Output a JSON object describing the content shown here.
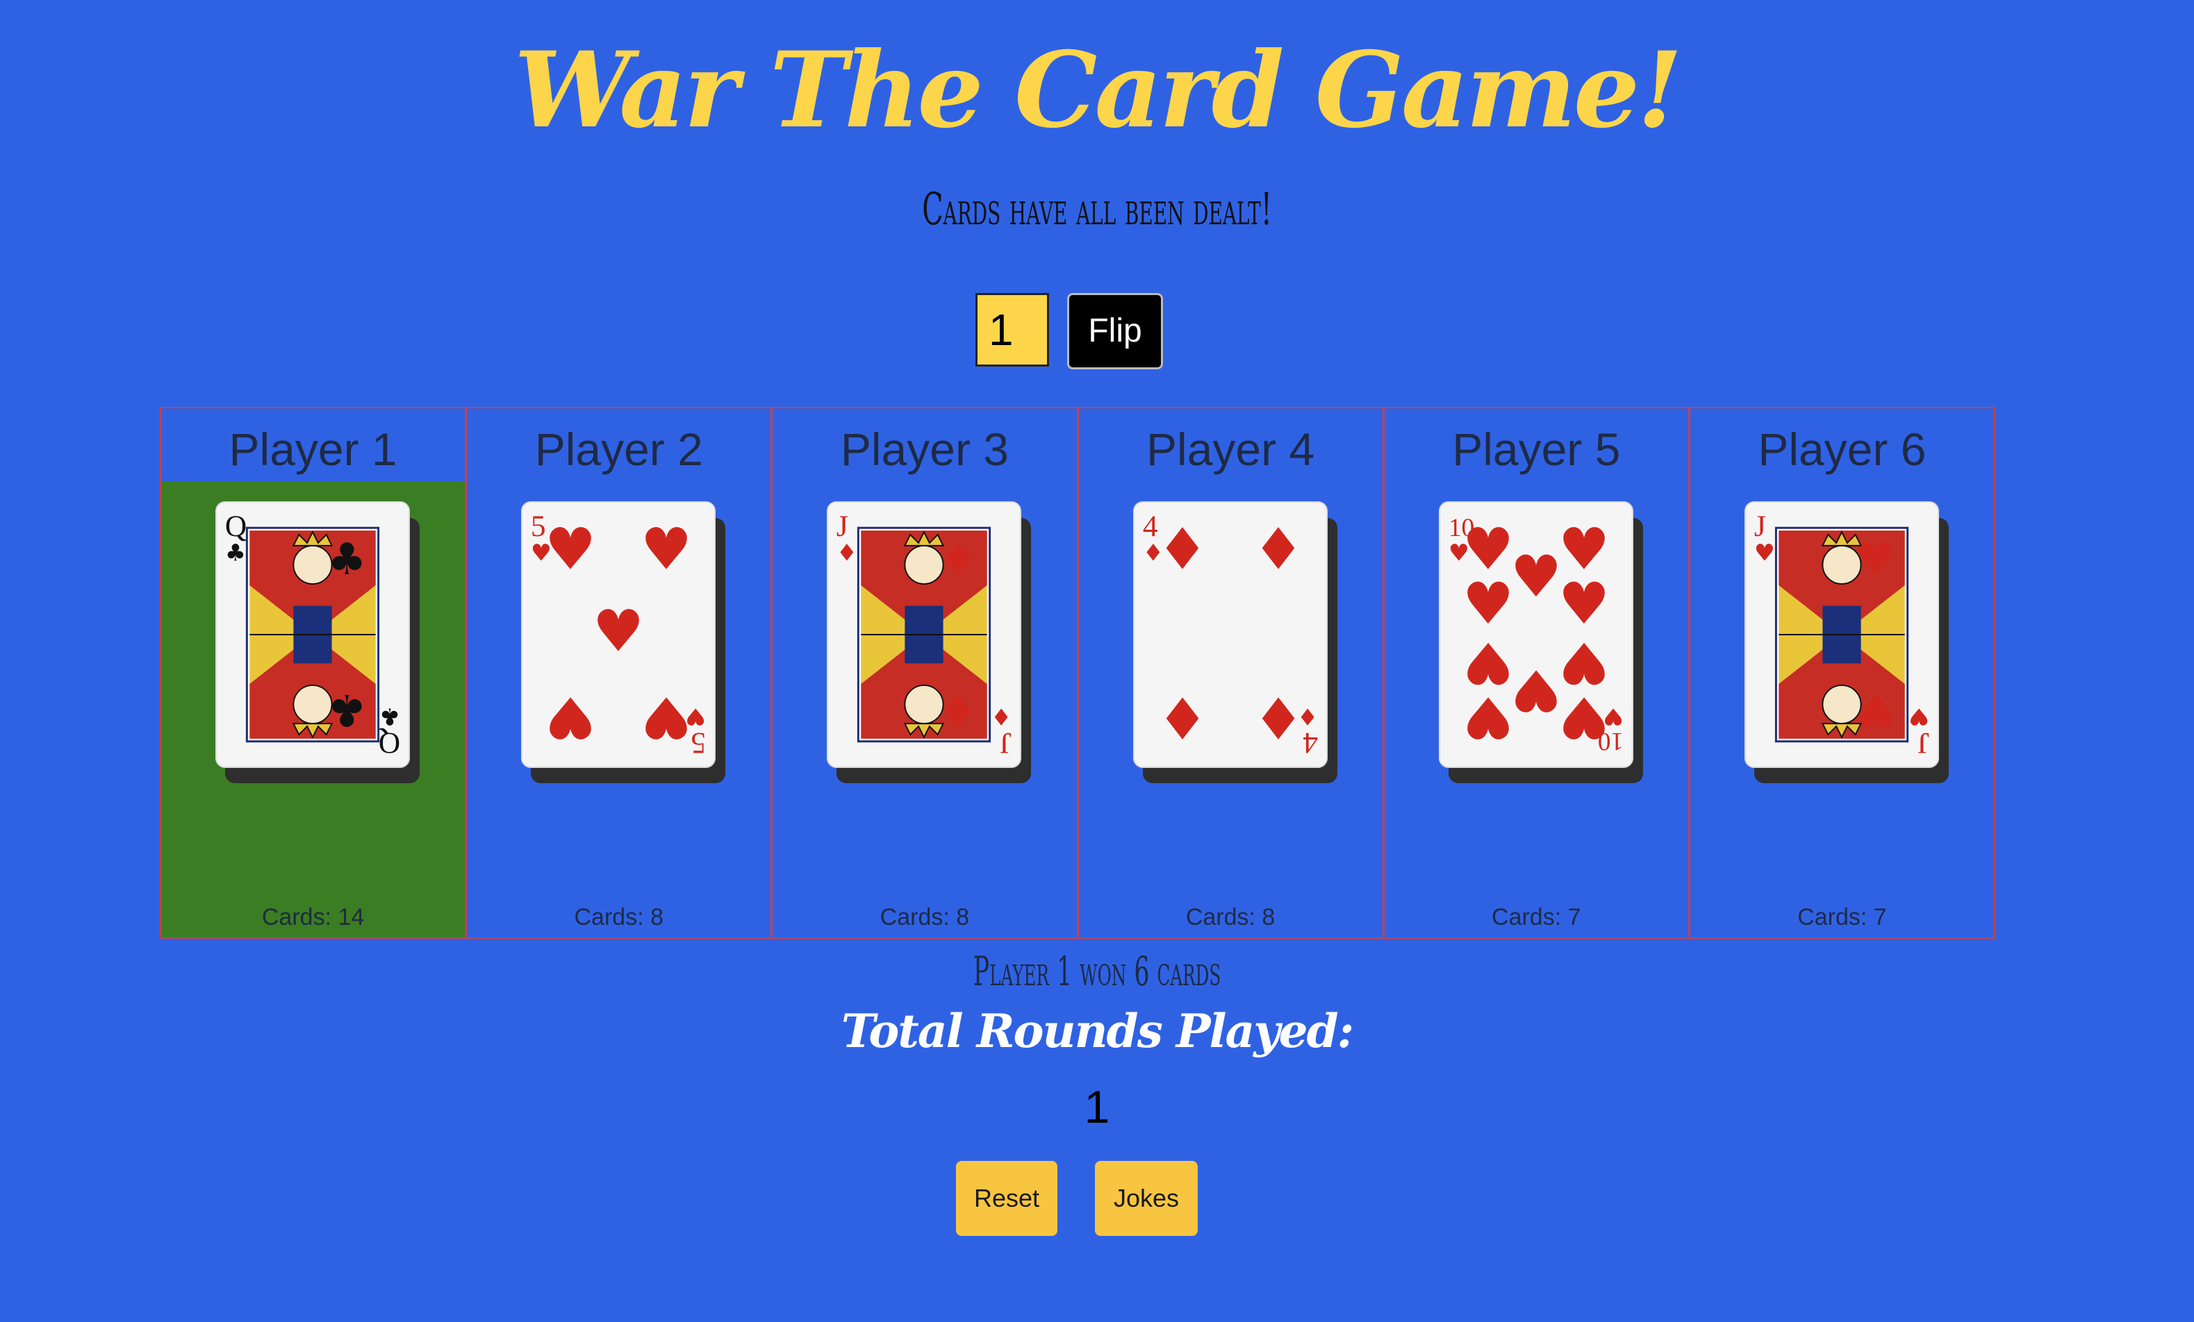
{
  "app": {
    "title": "War The Card Game!",
    "status": "Cards have all been dealt!"
  },
  "controls": {
    "bet_value": "1",
    "flip_label": "Flip"
  },
  "players": [
    {
      "name": "Player 1",
      "count_text": "Cards: 14",
      "winner": true,
      "card": {
        "rank": "Q",
        "suit": "clubs",
        "suit_symbol": "♣",
        "color": "#111111"
      }
    },
    {
      "name": "Player 2",
      "count_text": "Cards: 8",
      "winner": false,
      "card": {
        "rank": "5",
        "suit": "hearts",
        "suit_symbol": "♥",
        "color": "#d1261d"
      }
    },
    {
      "name": "Player 3",
      "count_text": "Cards: 8",
      "winner": false,
      "card": {
        "rank": "J",
        "suit": "diamonds",
        "suit_symbol": "♦",
        "color": "#d1261d"
      }
    },
    {
      "name": "Player 4",
      "count_text": "Cards: 8",
      "winner": false,
      "card": {
        "rank": "4",
        "suit": "diamonds",
        "suit_symbol": "♦",
        "color": "#d1261d"
      }
    },
    {
      "name": "Player 5",
      "count_text": "Cards: 7",
      "winner": false,
      "card": {
        "rank": "10",
        "suit": "hearts",
        "suit_symbol": "♥",
        "color": "#d1261d"
      }
    },
    {
      "name": "Player 6",
      "count_text": "Cards: 7",
      "winner": false,
      "card": {
        "rank": "J",
        "suit": "hearts",
        "suit_symbol": "♥",
        "color": "#d1261d"
      }
    }
  ],
  "result": {
    "message": "Player 1 won 6 cards",
    "rounds_label": "Total Rounds Played:",
    "rounds_value": "1"
  },
  "buttons": {
    "reset_label": "Reset",
    "jokes_label": "Jokes"
  },
  "colors": {
    "background": "#2f62e3",
    "accent_yellow": "#fcd54a",
    "winner_green": "#3a7d22",
    "border_red": "#c9404a",
    "button_yellow": "#f7c540"
  }
}
